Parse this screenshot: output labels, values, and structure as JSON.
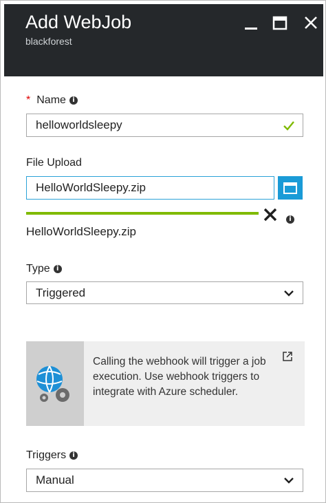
{
  "header": {
    "title": "Add WebJob",
    "subtitle": "blackforest",
    "minimize_icon": "minimize-icon",
    "maximize_icon": "maximize-icon",
    "close_icon": "close-icon",
    "background": "#25282b"
  },
  "form": {
    "name": {
      "label": "Name",
      "required_mark": "*",
      "value": "helloworldsleepy",
      "valid_icon": "checkmark-icon"
    },
    "file_upload": {
      "label": "File Upload",
      "value": "HelloWorldSleepy.zip",
      "browse_icon": "folder-icon",
      "progress": 1.0,
      "uploaded_file": "HelloWorldSleepy.zip"
    },
    "type": {
      "label": "Type",
      "selected": "Triggered"
    },
    "info_box": {
      "text": "Calling the webhook will trigger a job execution. Use webhook triggers to integrate with Azure scheduler.",
      "icon": "webhook-gears-icon",
      "link_icon": "external-link-icon"
    },
    "triggers": {
      "label": "Triggers",
      "selected": "Manual"
    }
  },
  "colors": {
    "accent": "#1a9bd7",
    "success": "#7fba00",
    "required": "#e00000"
  },
  "info_glyph": "i"
}
